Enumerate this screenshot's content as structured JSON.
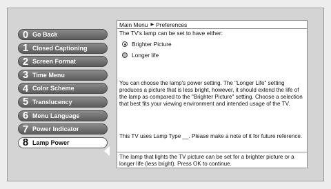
{
  "menu": {
    "items": [
      {
        "num": "0",
        "label": "Go Back"
      },
      {
        "num": "1",
        "label": "Closed Captioning"
      },
      {
        "num": "2",
        "label": "Screen Format"
      },
      {
        "num": "3",
        "label": "Time Menu"
      },
      {
        "num": "4",
        "label": "Color Scheme"
      },
      {
        "num": "5",
        "label": "Translucency"
      },
      {
        "num": "6",
        "label": "Menu Language"
      },
      {
        "num": "7",
        "label": "Power Indicator"
      },
      {
        "num": "8",
        "label": "Lamp Power"
      }
    ],
    "selected_index": 8
  },
  "panel": {
    "breadcrumb": {
      "root": "Main Menu",
      "current": "Preferences"
    },
    "prompt": "The TV's lamp can be set to have either:",
    "options": [
      {
        "label": "Brighter Picture",
        "checked": true
      },
      {
        "label": "Longer life",
        "checked": false
      }
    ],
    "description": "You can choose the lamp's power setting. The \"Longer Life\" setting produces a picture that is less bright, however, it should extend the life of the lamp as compared to the \"Brighter Picture\" setting. Choose a selection that best fits your viewing environment and intended usage of the TV.",
    "note": "This TV uses Lamp Type __. Please make a note of it for future reference.",
    "footer": "The lamp that lights the TV picture can be set for a brighter picture or a longer life (less bright). Press OK to continue."
  }
}
